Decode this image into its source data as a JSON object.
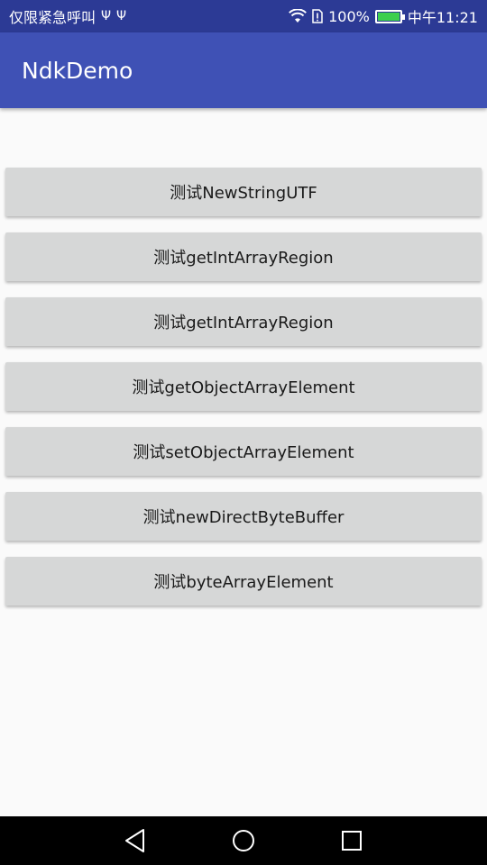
{
  "status_bar": {
    "carrier_text": "仅限紧急呼叫",
    "usb_icons": [
      "usb-icon",
      "usb-icon"
    ],
    "battery_percent": "100%",
    "battery_level": 1.0,
    "time": "中午11:21"
  },
  "app_bar": {
    "title": "NdkDemo"
  },
  "buttons": [
    {
      "label": "测试NewStringUTF"
    },
    {
      "label": "测试getIntArrayRegion"
    },
    {
      "label": "测试getIntArrayRegion"
    },
    {
      "label": "测试getObjectArrayElement"
    },
    {
      "label": "测试setObjectArrayElement"
    },
    {
      "label": "测试newDirectByteBuffer"
    },
    {
      "label": "测试byteArrayElement"
    }
  ],
  "nav_bar": {
    "icons": [
      "back-icon",
      "home-icon",
      "recents-icon"
    ]
  },
  "colors": {
    "primary": "#3f51b5",
    "primary_dark": "#2c3a95",
    "button": "#d6d7d7",
    "battery": "#3ccf4e"
  }
}
